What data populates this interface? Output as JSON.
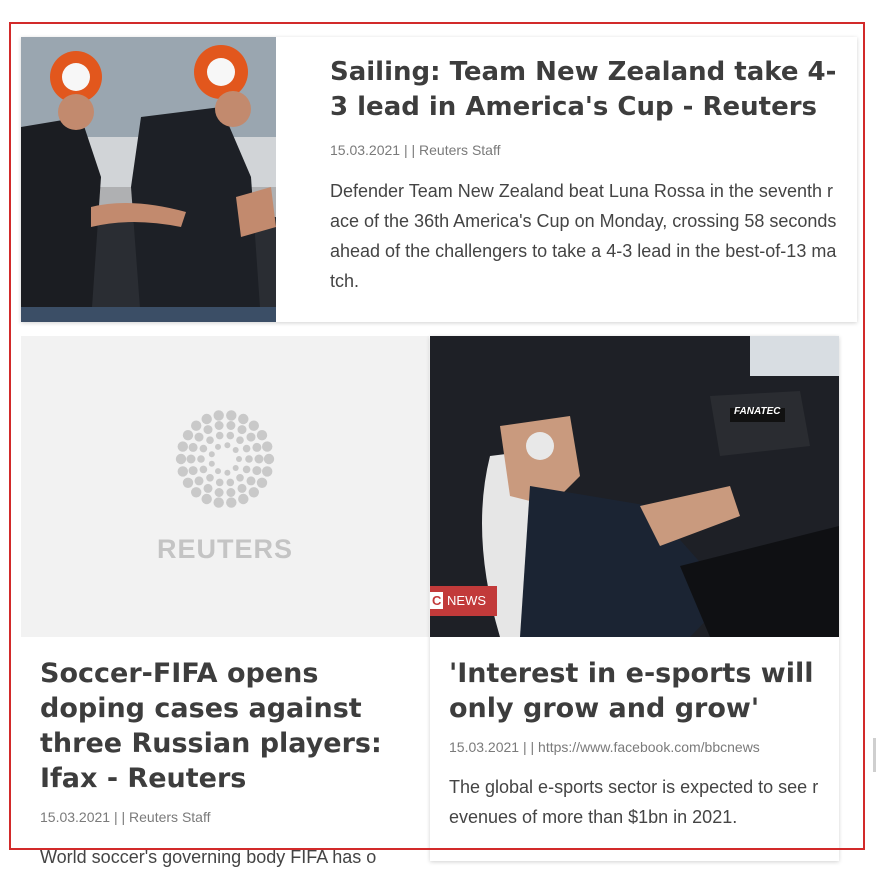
{
  "articles": [
    {
      "title": "Sailing: Team New Zealand take 4-3 lead in America's Cup - Reuters",
      "date": "15.03.2021",
      "separator": "| |",
      "author": "Reuters Staff",
      "excerpt": "Defender Team New Zealand beat Luna Rossa in the seventh race of the 36th America's Cup on Monday, crossing 58 seconds ahead of the challengers to take a 4-3 lead in the best-of-13 match.",
      "image_icon": "sailors-photo"
    },
    {
      "title": "Soccer-FIFA opens doping cases against three Russian players: Ifax - Reuters",
      "date": "15.03.2021",
      "separator": "| |",
      "author": "Reuters Staff",
      "excerpt": "World soccer's governing body FIFA has o",
      "image_logo_text": "REUTERS"
    },
    {
      "title": "'Interest in e-sports will only grow and grow'",
      "date": "15.03.2021",
      "separator": "| |",
      "author": "https://www.facebook.com/bbcnews",
      "excerpt": "The global e-sports sector is expected to see revenues of more than $1bn in 2021.",
      "badge_letter": "C",
      "badge_text": "NEWS",
      "image_overlay": "FANATEC"
    }
  ],
  "colors": {
    "frame": "#d22a2a",
    "title": "#3d3d3d",
    "meta": "#7a7a7a",
    "badge": "#c23a3a"
  }
}
